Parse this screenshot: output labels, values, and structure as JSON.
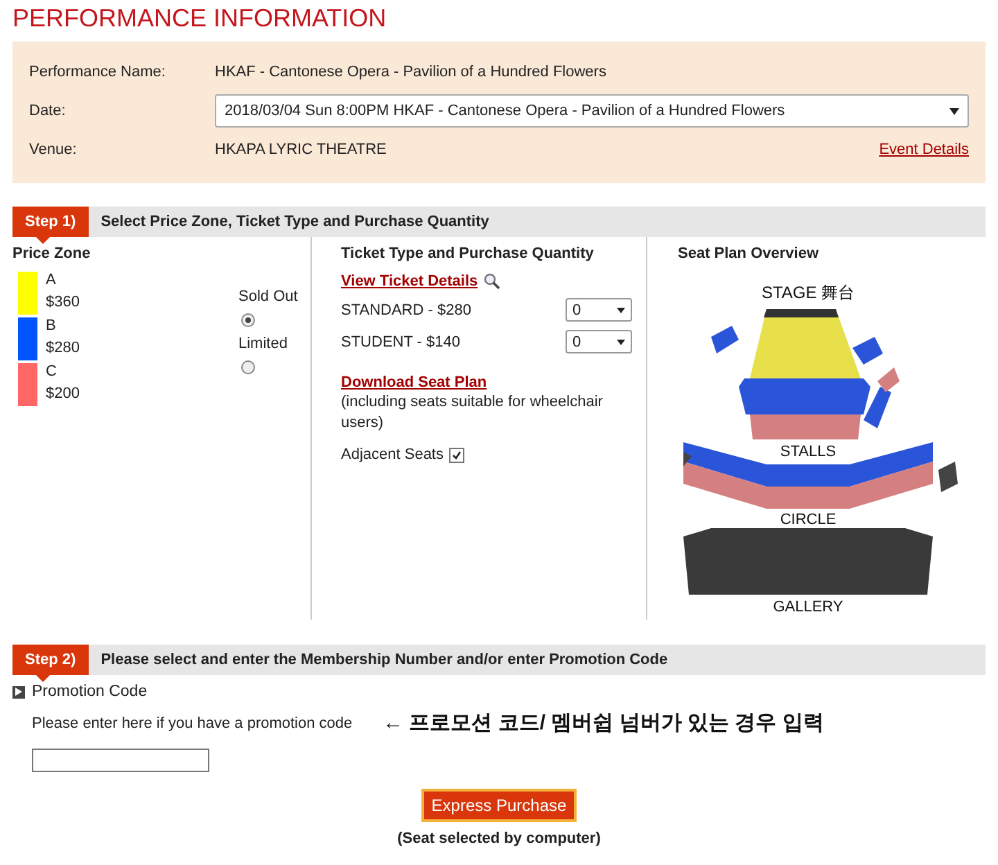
{
  "page_title": "PERFORMANCE INFORMATION",
  "performance": {
    "fields": [
      {
        "label": "Performance Name:",
        "kind": "text",
        "value": "HKAF - Cantonese Opera - Pavilion of a Hundred Flowers"
      },
      {
        "label": "Date:",
        "kind": "select",
        "value": "2018/03/04 Sun 8:00PM HKAF - Cantonese Opera - Pavilion of a Hundred Flowers"
      },
      {
        "label": "Venue:",
        "kind": "text",
        "value": "HKAPA LYRIC THEATRE",
        "link": "Event Details"
      }
    ]
  },
  "step1": {
    "badge": "Step 1)",
    "title": "Select Price Zone, Ticket Type and Purchase Quantity",
    "price_zone": {
      "heading": "Price Zone",
      "zones": [
        {
          "name": "A",
          "price": "$360",
          "color": "#ffff00"
        },
        {
          "name": "B",
          "price": "$280",
          "color": "#0055ff"
        },
        {
          "name": "C",
          "price": "$200",
          "color": "#ff6666"
        }
      ],
      "legend": [
        {
          "label": "Sold Out",
          "selected": true
        },
        {
          "label": "Limited",
          "selected": false
        }
      ]
    },
    "tickets": {
      "heading": "Ticket Type and Purchase Quantity",
      "details_link": "View Ticket Details",
      "types": [
        {
          "label": "STANDARD - $280",
          "quantity": "0"
        },
        {
          "label": "STUDENT - $140",
          "quantity": "0"
        }
      ],
      "seat_plan_link": "Download Seat Plan",
      "seat_plan_note": "(including seats suitable for wheelchair users)",
      "adjacent": {
        "label": "Adjacent Seats",
        "checked": true
      }
    },
    "seat_plan": {
      "heading": "Seat Plan Overview",
      "stage": "STAGE 舞台",
      "stalls": "STALLS",
      "circle": "CIRCLE",
      "gallery": "GALLERY"
    }
  },
  "step2": {
    "badge": "Step 2)",
    "title": "Please select and enter the Membership Number and/or enter Promotion Code",
    "section": "Promotion Code",
    "hint": "Please enter here if you have a promotion code",
    "annotation": "← 프로모션 코드/ 멤버쉽 넘버가 있는 경우 입력"
  },
  "button": "Express Purchase",
  "button_note": "(Seat selected by computer)"
}
